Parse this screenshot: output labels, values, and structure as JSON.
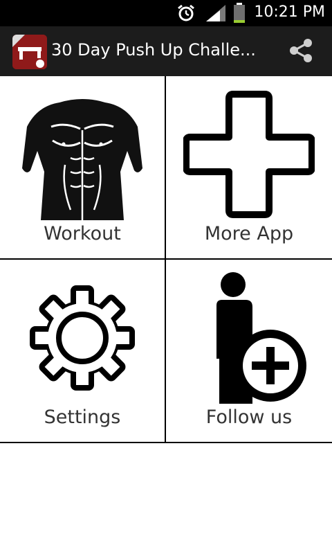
{
  "status_bar": {
    "time": "10:21 PM",
    "icons": [
      "alarm-icon",
      "signal-icon",
      "battery-icon"
    ]
  },
  "action_bar": {
    "title": "30 Day Push Up Challe...",
    "app_icon": "pushup-app-icon",
    "share_icon": "share-icon"
  },
  "menu": {
    "tiles": [
      {
        "label": "Workout",
        "icon": "torso-icon"
      },
      {
        "label": "More App",
        "icon": "plus-cross-icon"
      },
      {
        "label": "Settings",
        "icon": "gear-icon"
      },
      {
        "label": "Follow us",
        "icon": "person-add-icon"
      }
    ]
  },
  "colors": {
    "status_bar_bg": "#000000",
    "action_bar_bg": "#1c1c1c",
    "app_icon_bg": "#8f1a1a",
    "battery_fill": "#9acd32"
  }
}
